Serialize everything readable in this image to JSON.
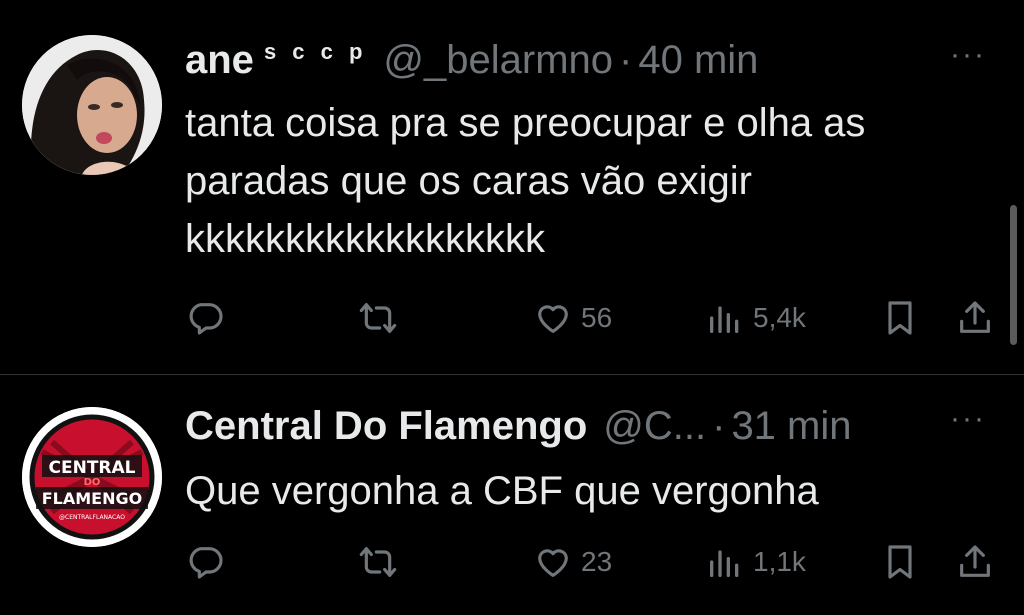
{
  "tweets": [
    {
      "name": "ane",
      "name_suffix": "s c c p",
      "handle": "@_belarmno",
      "separator": "·",
      "time": "40 min",
      "more": "···",
      "text_lines": [
        "tanta coisa pra se preocupar e olha as",
        "paradas que os caras vão exigir",
        "kkkkkkkkkkkkkkkkkk"
      ],
      "likes": "56",
      "views": "5,4k"
    },
    {
      "name": "Central Do Flamengo",
      "handle": "@C...",
      "separator": "·",
      "time": "31 min",
      "more": "···",
      "text_lines": [
        "Que vergonha a CBF que vergonha"
      ],
      "likes": "23",
      "views": "1,1k",
      "avatar_logo": {
        "line1": "CENTRAL",
        "line2": "DO",
        "line3": "FLAMENGO",
        "line4": "@CENTRALFLANACAO"
      }
    }
  ],
  "colors": {
    "background": "#000000",
    "text": "#e7e9ea",
    "muted": "#71767b",
    "divider": "#2f3336",
    "flamengo_red": "#c8102e"
  },
  "icons": [
    "reply-icon",
    "retweet-icon",
    "like-icon",
    "views-icon",
    "bookmark-icon",
    "share-icon",
    "more-icon"
  ]
}
